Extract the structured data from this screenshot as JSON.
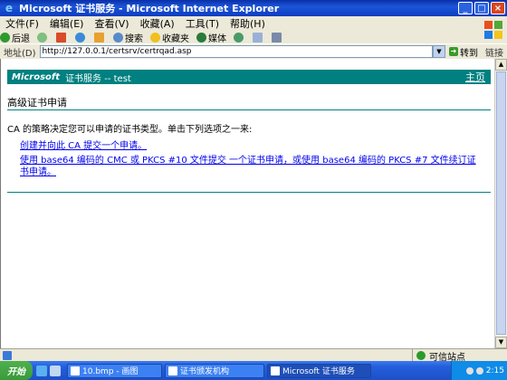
{
  "window": {
    "title": "Microsoft 证书服务 - Microsoft Internet Explorer",
    "controls": {
      "minimize": "_",
      "maximize": "□",
      "close": "×"
    }
  },
  "menu": {
    "items": [
      "文件(F)",
      "编辑(E)",
      "查看(V)",
      "收藏(A)",
      "工具(T)",
      "帮助(H)"
    ]
  },
  "toolbar": {
    "back_label": "后退",
    "search_label": "搜索",
    "favorites_label": "收藏夹",
    "media_label": "媒体",
    "icons": [
      "back-arrow-icon",
      "forward-arrow-icon",
      "stop-icon",
      "refresh-icon",
      "home-icon",
      "search-icon",
      "favorites-star-icon",
      "media-icon",
      "history-icon",
      "mail-icon",
      "print-icon"
    ]
  },
  "address": {
    "label": "地址(D)",
    "url": "http://127.0.0.1/certsrv/certrqad.asp",
    "go_label": "转到",
    "links_label": "链接"
  },
  "page": {
    "banner": {
      "brand": "Microsoft",
      "service": "证书服务  --  test",
      "home_link": "主页"
    },
    "heading": "高级证书申请",
    "intro": "CA 的策略决定您可以申请的证书类型。单击下列选项之一来:",
    "links": [
      "创建并向此 CA 提交一个申请。",
      "使用 base64 编码的 CMC 或 PKCS #10 文件提交 一个证书申请，或使用 base64 编码的 PKCS #7 文件续订证书申请。"
    ]
  },
  "status": {
    "left": "",
    "zone": "可信站点"
  },
  "taskbar": {
    "start_label": "开始",
    "tasks": [
      {
        "label": "10.bmp - 画图",
        "active": false
      },
      {
        "label": "证书颁发机构",
        "active": false
      },
      {
        "label": "Microsoft 证书服务",
        "active": true
      }
    ],
    "clock": "2:15"
  },
  "colors": {
    "banner": "#008080",
    "link": "#0000ee",
    "titlebar": "#0a2fa8",
    "taskbar": "#245edb"
  }
}
